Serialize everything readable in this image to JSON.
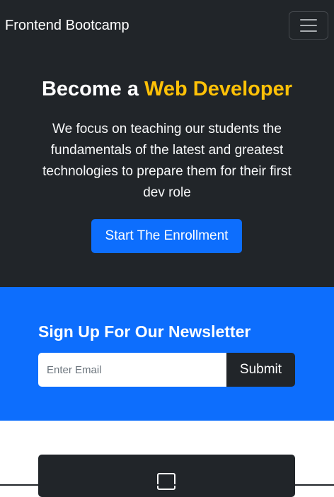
{
  "navbar": {
    "brand": "Frontend Bootcamp",
    "toggler_icon": "hamburger-menu-icon"
  },
  "hero": {
    "title_prefix": "Become a ",
    "title_accent": "Web Developer",
    "lead": "We focus on teaching our students the fundamentals of the latest and greatest technologies to prepare them for their first dev role",
    "button_label": "Start The Enrollment"
  },
  "newsletter": {
    "heading": "Sign Up For Our Newsletter",
    "email_placeholder": "Enter Email",
    "email_value": "",
    "submit_label": "Submit"
  },
  "card": {
    "icon": "laptop-icon"
  },
  "colors": {
    "dark": "#212529",
    "primary": "#0d6efd",
    "accent": "#ffc107",
    "white": "#ffffff"
  }
}
